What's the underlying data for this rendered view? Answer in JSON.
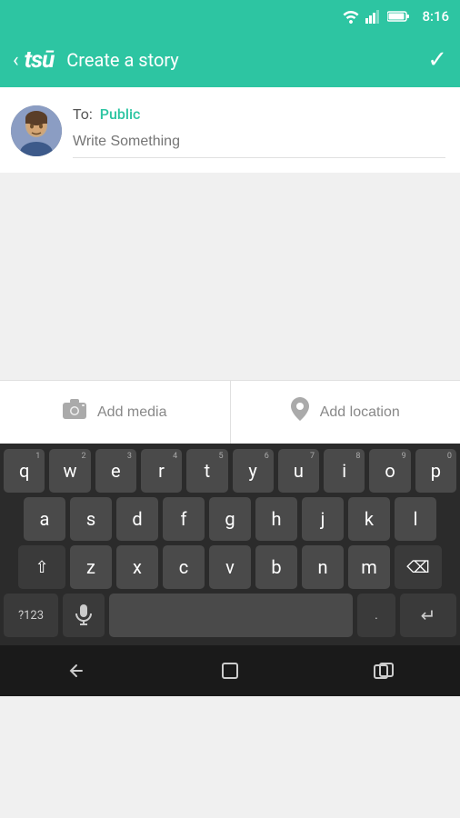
{
  "statusBar": {
    "time": "8:16"
  },
  "appBar": {
    "back": "‹",
    "logo": "tsū",
    "title": "Create a story",
    "check": "✓"
  },
  "compose": {
    "toLabel": "To:",
    "toValue": "Public",
    "placeholder": "Write Something"
  },
  "toolbar": {
    "addMediaLabel": "Add media",
    "addLocationLabel": "Add location"
  },
  "keyboard": {
    "row1": [
      {
        "char": "q",
        "num": "1"
      },
      {
        "char": "w",
        "num": "2"
      },
      {
        "char": "e",
        "num": "3"
      },
      {
        "char": "r",
        "num": "4"
      },
      {
        "char": "t",
        "num": "5"
      },
      {
        "char": "y",
        "num": "6"
      },
      {
        "char": "u",
        "num": "7"
      },
      {
        "char": "i",
        "num": "8"
      },
      {
        "char": "o",
        "num": "9"
      },
      {
        "char": "p",
        "num": "0"
      }
    ],
    "row2": [
      {
        "char": "a"
      },
      {
        "char": "s"
      },
      {
        "char": "d"
      },
      {
        "char": "f"
      },
      {
        "char": "g"
      },
      {
        "char": "h"
      },
      {
        "char": "j"
      },
      {
        "char": "k"
      },
      {
        "char": "l"
      }
    ],
    "row3": [
      {
        "char": "z"
      },
      {
        "char": "x"
      },
      {
        "char": "c"
      },
      {
        "char": "v"
      },
      {
        "char": "b"
      },
      {
        "char": "n"
      },
      {
        "char": "m"
      }
    ],
    "specialKeys": {
      "shift": "⇧",
      "backspace": "⌫",
      "num123": "?123",
      "mic": "🎤",
      "period": ".",
      "return": "↵"
    }
  },
  "navBar": {
    "back": "←",
    "home": "⬜",
    "recents": "▣"
  }
}
